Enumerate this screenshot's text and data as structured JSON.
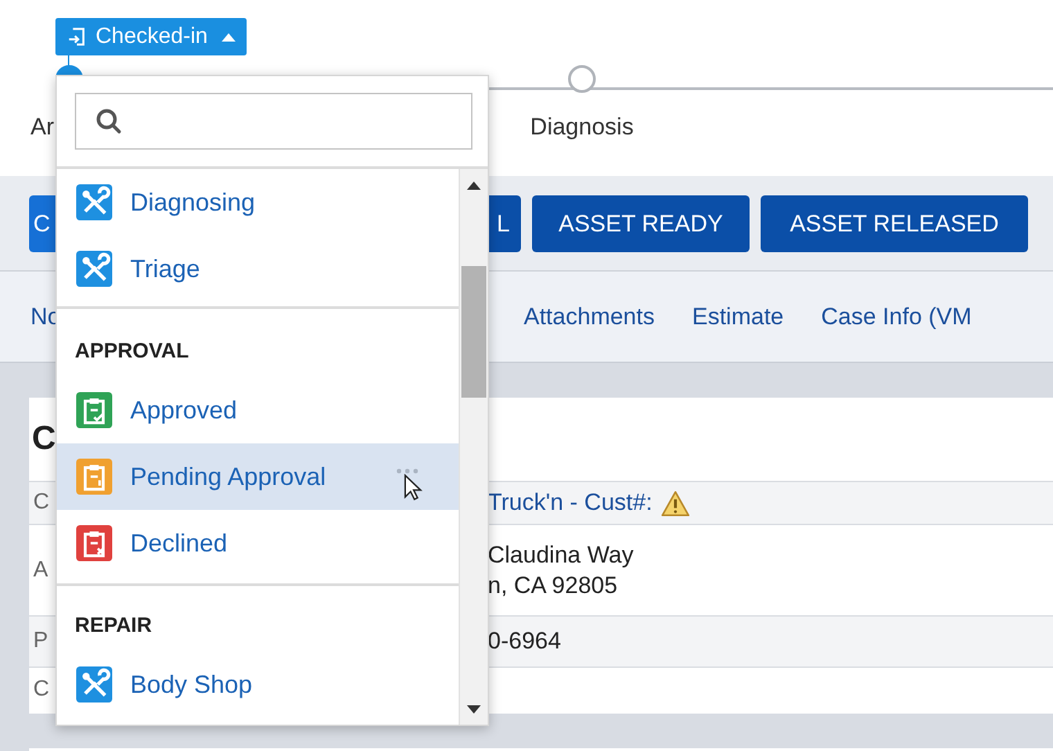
{
  "status_button": {
    "label": "Checked-in",
    "expanded": true
  },
  "steps": [
    {
      "label": "Ar",
      "done": true
    },
    {
      "label": "Diagnosis",
      "done": false
    }
  ],
  "actions": [
    {
      "label": "C",
      "kind": "primary"
    },
    {
      "label": "L",
      "kind": "secondary"
    },
    {
      "label": "ASSET READY",
      "kind": "secondary"
    },
    {
      "label": "ASSET RELEASED",
      "kind": "secondary"
    }
  ],
  "tabs": [
    "No",
    "Attachments",
    "Estimate",
    "Case Info (VM"
  ],
  "card": {
    "title": "C",
    "rows": [
      {
        "label": "C",
        "lines": [
          "Truck'n - Cust#:"
        ],
        "link": true,
        "warning": true
      },
      {
        "label": "A",
        "lines": [
          "Claudina Way",
          "n, CA 92805"
        ],
        "link": false,
        "warning": false
      },
      {
        "label": "P",
        "lines": [
          "0-6964"
        ],
        "link": false,
        "warning": false
      },
      {
        "label": "C",
        "lines": [],
        "warning": false
      }
    ]
  },
  "status_menu": {
    "groups": [
      {
        "items": [
          {
            "label": "Diagnosing",
            "kind": "tools",
            "color": "#1e90e0",
            "highlighted": false
          },
          {
            "label": "Triage",
            "kind": "tools",
            "color": "#1e90e0",
            "highlighted": false
          }
        ]
      },
      {
        "heading": "APPROVAL",
        "items": [
          {
            "label": "Approved",
            "kind": "approved",
            "color": "#2fa356",
            "highlighted": false
          },
          {
            "label": "Pending Approval",
            "kind": "pending",
            "color": "#f0a030",
            "highlighted": true
          },
          {
            "label": "Declined",
            "kind": "declined",
            "color": "#e0413e",
            "highlighted": false
          }
        ]
      },
      {
        "heading": "REPAIR",
        "items": [
          {
            "label": "Body Shop",
            "kind": "tools",
            "color": "#1e90e0",
            "highlighted": false
          }
        ]
      }
    ]
  }
}
